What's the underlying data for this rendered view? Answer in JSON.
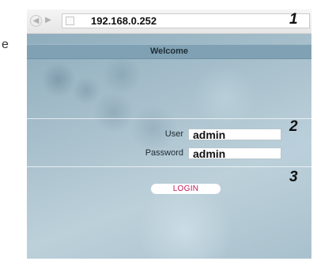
{
  "side": {
    "text": "e"
  },
  "browser": {
    "back_icon": "back-arrow-icon",
    "forward_icon": "forward-arrow-icon",
    "url": "192.168.0.252"
  },
  "markers": {
    "m1": "1",
    "m2": "2",
    "m3": "3"
  },
  "page": {
    "welcome": "Welcome",
    "user_label": "User",
    "user_value": "admin",
    "password_label": "Password",
    "password_value": "admin",
    "login_label": "LOGIN"
  },
  "colors": {
    "welcome_bar": "#7fa1b3",
    "login_text": "#c2185b"
  }
}
